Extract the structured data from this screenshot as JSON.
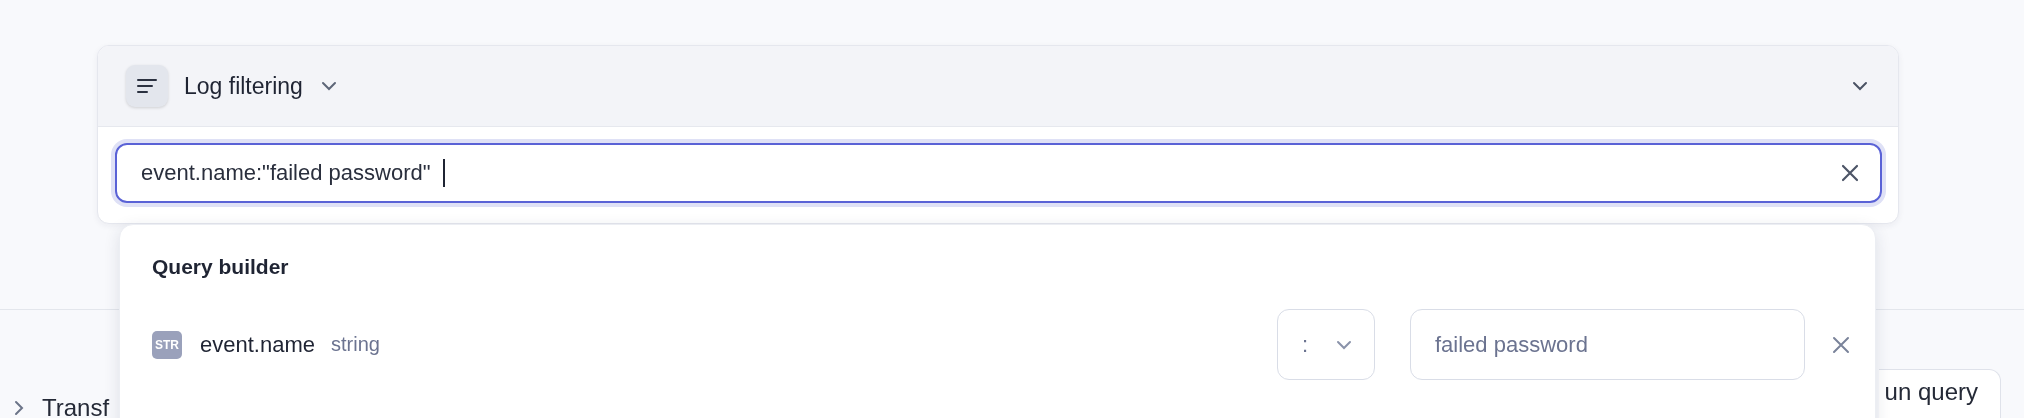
{
  "filter": {
    "title": "Log filtering",
    "query": "event.name:\"failed password\""
  },
  "query_builder": {
    "title": "Query builder",
    "conditions": [
      {
        "type_badge": "STR",
        "field": "event.name",
        "type": "string",
        "operator": ":",
        "value": "failed password"
      }
    ]
  },
  "sections": [
    {
      "label": "Transf",
      "expanded": false
    }
  ],
  "run_button": {
    "label": "un query"
  }
}
